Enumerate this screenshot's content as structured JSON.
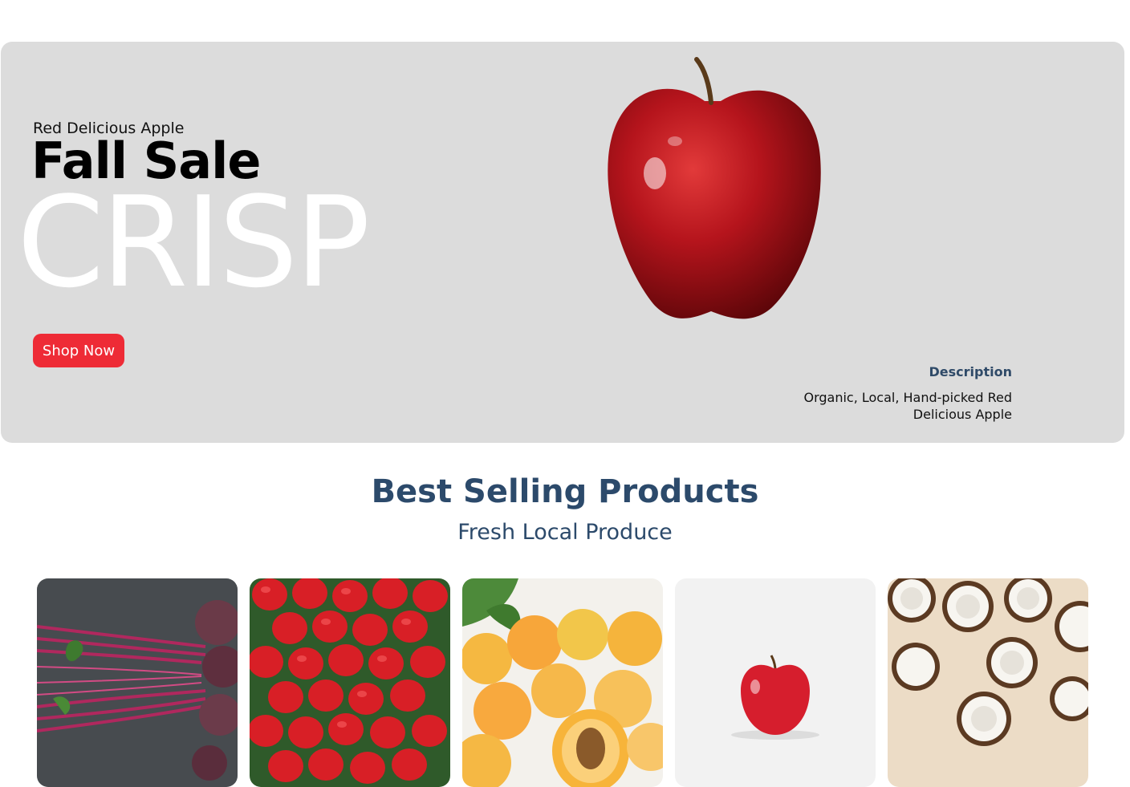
{
  "hero": {
    "subtitle": "Red Delicious Apple",
    "title": "Fall Sale",
    "big_word": "CRISP",
    "button_label": "Shop Now",
    "description_heading": "Description",
    "description_text": "Organic, Local, Hand-picked Red Delicious Apple",
    "background_color": "#dcdcdc",
    "button_color": "#ee2b36"
  },
  "products": {
    "title": "Best Selling Products",
    "subtitle": "Fresh Local Produce",
    "heading_color": "#2c4a6b",
    "cards": [
      {
        "name": "beets"
      },
      {
        "name": "strawberries"
      },
      {
        "name": "apricots"
      },
      {
        "name": "apple"
      },
      {
        "name": "coconuts"
      }
    ]
  }
}
